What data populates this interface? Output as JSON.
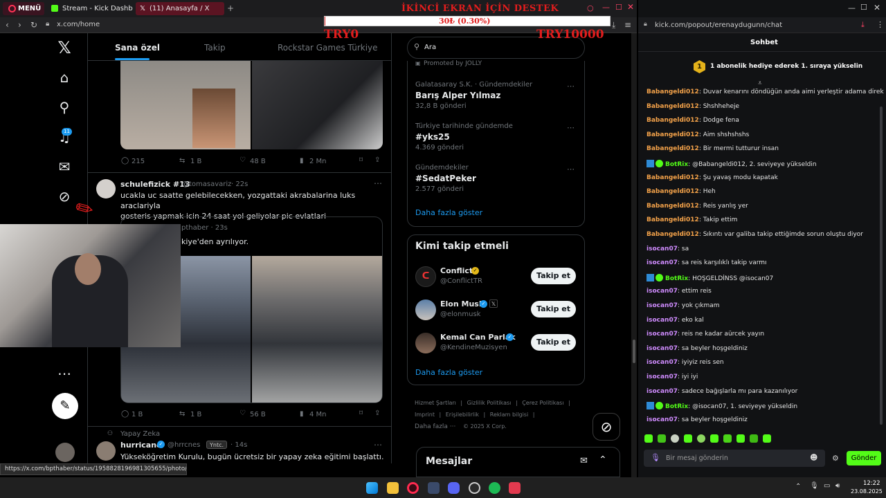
{
  "browser_left": {
    "menu_label": "MENÜ",
    "tabs": [
      {
        "label": "Stream - Kick Dashboard"
      },
      {
        "label": "(11) Anasayfa / X"
      }
    ],
    "url": "x.com/home"
  },
  "overlay": {
    "title": "İKİNCİ EKRAN İÇİN DESTEK",
    "progress_label": "30₺ (0.30%)",
    "progress_fraction": 0.003,
    "min_label": "TRY0",
    "max_label": "TRY10000"
  },
  "x_sidebar": {
    "notification_count": "11"
  },
  "timeline": {
    "tabs": [
      "Sana özel",
      "Takip",
      "Rockstar Games Türkiye"
    ],
    "post1_stats": {
      "replies": "215",
      "reposts": "1 B",
      "likes": "48 B",
      "views": "2 Mn"
    },
    "post2": {
      "name": "schulefizick #13",
      "handle": "@tomasavariz",
      "time": "· 22s",
      "text1": "ucakla uc saatte gelebilecekken, yozgattaki akrabalarina luks araclariyla",
      "text2": "gosteris yapmak icin 24 saat yol geliyolar pic evlatlari",
      "quote_handle": "pthaber · 23s",
      "quote_text": "kiye'den ayrılıyor.",
      "stats": {
        "replies": "1 B",
        "reposts": "1 B",
        "likes": "56 B",
        "views": "4 Mn"
      }
    },
    "post3": {
      "context": "Yapay Zeka",
      "name": "hurricane",
      "handle": "@hrrcnes",
      "badge": "Yntc.",
      "time": "· 14s",
      "text": "Yükseköğretim Kurulu, bugün ücretsiz bir yapay zeka eğitimi başlattı."
    },
    "status_url": "https://x.com/bpthaber/status/1958828196981305655/photo/1"
  },
  "x_right": {
    "search_placeholder": "Ara",
    "promoted": "Promoted by JOLLY",
    "trends": [
      {
        "context": "Galatasaray S.K. · Gündemdekiler",
        "title": "Barış Alper Yılmaz",
        "count": "32,8 B gönderi"
      },
      {
        "context": "Türkiye tarihinde gündemde",
        "title": "#yks25",
        "count": "4.369 gönderi"
      },
      {
        "context": "Gündemdekiler",
        "title": "#SedatPeker",
        "count": "2.577 gönderi"
      }
    ],
    "show_more": "Daha fazla göster",
    "who_to_follow": "Kimi takip etmeli",
    "follow": [
      {
        "name": "Conflict",
        "handle": "@ConflictTR",
        "button": "Takip et"
      },
      {
        "name": "Elon Musk",
        "handle": "@elonmusk",
        "button": "Takip et"
      },
      {
        "name": "Kemal Can Parlak",
        "handle": "@KendineMuzisyen",
        "button": "Takip et"
      }
    ],
    "show_more2": "Daha fazla göster",
    "footer": [
      "Hizmet Şartları",
      "Gizlilik Politikası",
      "Çerez Politikası",
      "Imprint",
      "Erişilebilirlik",
      "Reklam bilgisi",
      "Daha fazla ···",
      "© 2025 X Corp."
    ],
    "messages": "Mesajlar"
  },
  "kick": {
    "url": "kick.com/popout/erenaydugunn/chat",
    "header": "Sohbet",
    "gift_rank": "1",
    "gift_text": "1 abonelik hediye ederek 1. sıraya yükselin",
    "messages": [
      {
        "user": "Babangeldi012",
        "text": "Duvar kenarını döndüğün anda aimi yerleştir adama direk",
        "type": "b"
      },
      {
        "user": "Babangeldi012",
        "text": "Shshheheje",
        "type": "b"
      },
      {
        "user": "Babangeldi012",
        "text": "Dodge fena",
        "type": "b"
      },
      {
        "user": "Babangeldi012",
        "text": "Aim shshshshs",
        "type": "b"
      },
      {
        "user": "Babangeldi012",
        "text": "Bir mermi tutturur insan",
        "type": "b"
      },
      {
        "user": "BotRix",
        "text": "@Babangeldi012, 2. seviyeye yükseldin",
        "type": "bot"
      },
      {
        "user": "Babangeldi012",
        "text": "Şu yavaş modu kapatak",
        "type": "b"
      },
      {
        "user": "Babangeldi012",
        "text": "Heh",
        "type": "b"
      },
      {
        "user": "Babangeldi012",
        "text": "Reis yanlış yer",
        "type": "b"
      },
      {
        "user": "Babangeldi012",
        "text": "Takip ettim",
        "type": "b"
      },
      {
        "user": "Babangeldi012",
        "text": "Sıkıntı var galiba takip ettiğimde sorun oluştu diyor",
        "type": "b"
      },
      {
        "user": "isocan07",
        "text": "sa",
        "type": "i"
      },
      {
        "user": "isocan07",
        "text": "sa reis karşılıklı takip varmı",
        "type": "i"
      },
      {
        "user": "BotRix",
        "text": "HOŞGELDİNSS @isocan07",
        "type": "bot"
      },
      {
        "user": "isocan07",
        "text": "ettim reis",
        "type": "i"
      },
      {
        "user": "isocan07",
        "text": "yok çıkmam",
        "type": "i"
      },
      {
        "user": "isocan07",
        "text": "eko kal",
        "type": "i"
      },
      {
        "user": "isocan07",
        "text": "reis ne kadar aürcek yayın",
        "type": "i"
      },
      {
        "user": "isocan07",
        "text": "sa beyler hoşgeldiniz",
        "type": "i"
      },
      {
        "user": "isocan07",
        "text": "iyiyiz reis sen",
        "type": "i"
      },
      {
        "user": "isocan07",
        "text": "iyi iyi",
        "type": "i"
      },
      {
        "user": "isocan07",
        "text": "sadece bağışlarla mı para kazanılıyor",
        "type": "i"
      },
      {
        "user": "BotRix",
        "text": "@isocan07, 1. seviyeye yükseldin",
        "type": "bot"
      },
      {
        "user": "isocan07",
        "text": "sa beyler hoşgeldiniz",
        "type": "i"
      }
    ],
    "input_placeholder": "Bir mesaj gönderin",
    "send_button": "Gönder"
  },
  "taskbar": {
    "time": "12:22",
    "date": "23.08.2025"
  }
}
